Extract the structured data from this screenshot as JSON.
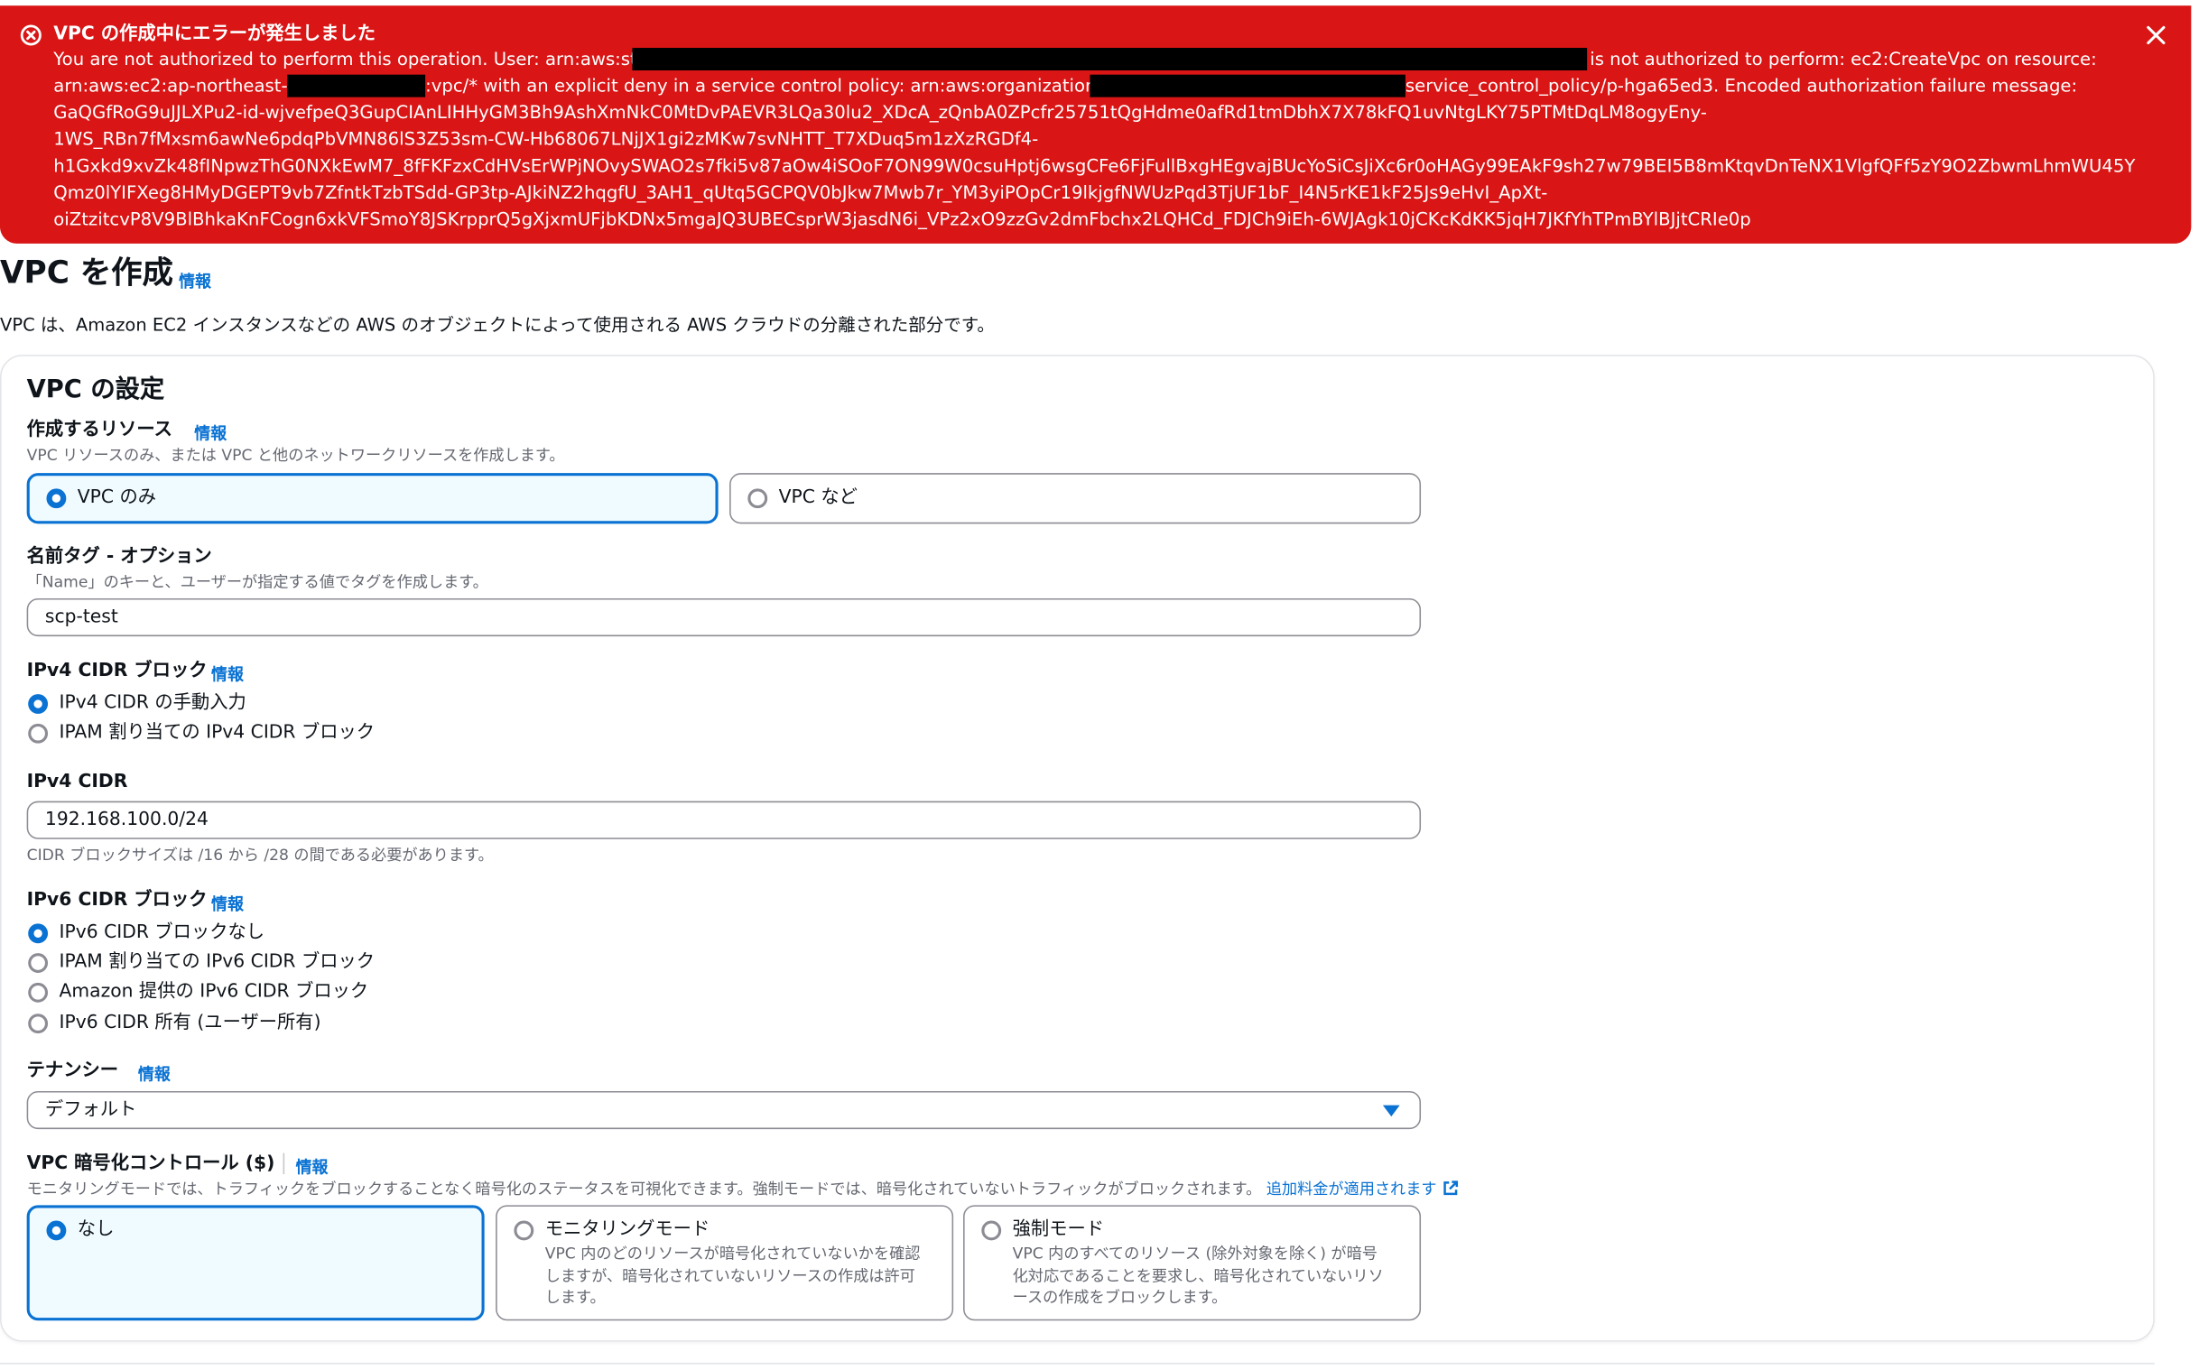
{
  "error": {
    "title": "VPC の作成中にエラーが発生しました",
    "line1_a": "You are not authorized to perform this operation. User: arn:aws:sts:",
    "line1_b": "is not authorized to perform: ec2:CreateVpc on resource:",
    "line2_a": "arn:aws:ec2:ap-northeast-1",
    "line2_b": ":vpc/* with an explicit deny in a service control policy: arn:aws:organizations::",
    "line2_c": "service_control_policy/p-hga65ed3. Encoded authorization failure message:",
    "line3": "GaQGfRoG9uJJLXPu2-id-wjvefpeQ3GupCIAnLIHHyGM3Bh9AshXmNkC0MtDvPAEVR3LQa30lu2_XDcA_zQnbA0ZPcfr25751tQgHdme0afRd1tmDbhX7X78kFQ1uvNtgLKY75PTMtDqLM8ogyEny-",
    "line4": "1WS_RBn7fMxsm6awNe6pdqPbVMN86lS3Z53sm-CW-Hb68067LNjJX1gi2zMKw7svNHTT_T7XDuq5m1zXzRGDf4-",
    "line5": "h1Gxkd9xvZk48fINpwzThG0NXkEwM7_8fFKFzxCdHVsErWPjNOvySWAO2s7fki5v87aOw4iSOoF7ON99W0csuHptj6wsgCFe6FjFullBxgHEgvajBUcYoSiCsJiXc6r0oHAGy99EAkF9sh27w79BEI5B8mKtqvDnTeNX1VlgfQFf5zY9O2ZbwmLhmWU45Y",
    "line6": "Qmz0lYIFXeg8HMyDGEPT9vb7ZfntkTzbTSdd-GP3tp-AJkiNZ2hqgfU_3AH1_qUtq5GCPQV0bJkw7Mwb7r_YM3yiPOpCr19lkjgfNWUzPqd3TjUF1bF_I4N5rKE1kF25Js9eHvI_ApXt-",
    "line7": "oiZtzitcvP8V9BlBhkaKnFCogn6xkVFSmoY8JSKrpprQ5gXjxmUFjbKDNx5mgaJQ3UBECsprW3jasdN6i_VPz2xO9zzGv2dmFbchx2LQHCd_FDJCh9iEh-6WJAgk10jCKcKdKK5jqH7JKfYhTPmBYlBJjtCRIe0p",
    "error_icon": "error-circle-icon",
    "close_icon": "close-icon",
    "color": "#d91515"
  },
  "page": {
    "title": "VPC を作成",
    "info": "情報",
    "description": "VPC は、Amazon EC2 インスタンスなどの AWS のオブジェクトによって使用される AWS クラウドの分離された部分です。"
  },
  "settings": {
    "title": "VPC の設定",
    "resources": {
      "label": "作成するリソース",
      "info": "情報",
      "hint": "VPC リソースのみ、または VPC と他のネットワークリソースを作成します。",
      "options": [
        "VPC のみ",
        "VPC など"
      ],
      "selected": "VPC のみ"
    },
    "name_tag": {
      "label": "名前タグ - オプション",
      "hint": "「Name」のキーと、ユーザーが指定する値でタグを作成します。",
      "value": "scp-test"
    },
    "ipv4_block": {
      "label": "IPv4 CIDR ブロック",
      "info": "情報",
      "options": [
        "IPv4 CIDR の手動入力",
        "IPAM 割り当ての IPv4 CIDR ブロック"
      ],
      "selected": "IPv4 CIDR の手動入力"
    },
    "ipv4_cidr": {
      "label": "IPv4 CIDR",
      "value": "192.168.100.0/24",
      "hint": "CIDR ブロックサイズは /16 から /28 の間である必要があります。"
    },
    "ipv6_block": {
      "label": "IPv6 CIDR ブロック",
      "info": "情報",
      "options": [
        "IPv6 CIDR ブロックなし",
        "IPAM 割り当ての IPv6 CIDR ブロック",
        "Amazon 提供の IPv6 CIDR ブロック",
        "IPv6 CIDR 所有 (ユーザー所有)"
      ],
      "selected": "IPv6 CIDR ブロックなし"
    },
    "tenancy": {
      "label": "テナンシー",
      "info": "情報",
      "value": "デフォルト"
    },
    "encryption": {
      "label": "VPC 暗号化コントロール ($)",
      "info": "情報",
      "hint": "モニタリングモードでは、トラフィックをブロックすることなく暗号化のステータスを可視化できます。強制モードでは、暗号化されていないトラフィックがブロックされます。",
      "hint_link": "追加料金が適用されます",
      "external_icon": "external-link-icon",
      "options": [
        {
          "label": "なし",
          "desc": ""
        },
        {
          "label": "モニタリングモード",
          "desc": "VPC 内のどのリソースが暗号化されていないかを確認しますが、暗号化されていないリソースの作成は許可します。"
        },
        {
          "label": "強制モード",
          "desc": "VPC 内のすべてのリソース (除外対象を除く) が暗号化対応であることを要求し、暗号化されていないリソースの作成をブロックします。"
        }
      ],
      "selected": "なし"
    }
  },
  "colors": {
    "accent": "#0972d3",
    "error": "#d91515",
    "selected_bg": "#f0fbff"
  }
}
